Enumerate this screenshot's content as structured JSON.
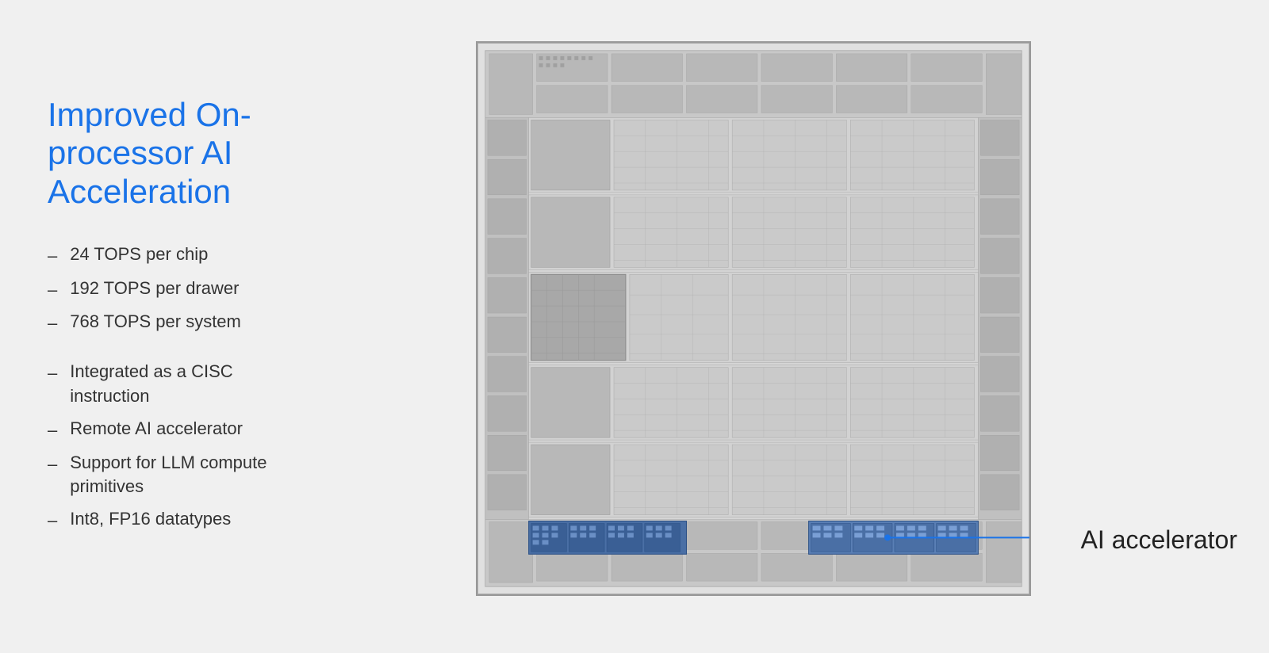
{
  "title": "Improved On-processor AI Acceleration",
  "bullets": {
    "group1": [
      {
        "text": "24 TOPS per chip"
      },
      {
        "text": "192 TOPS per drawer"
      },
      {
        "text": "768 TOPS per system"
      }
    ],
    "group2": [
      {
        "text": "Integrated as a CISC instruction"
      },
      {
        "text": "Remote AI accelerator"
      },
      {
        "text": "Support for LLM compute primitives"
      },
      {
        "text": "Int8, FP16 datatypes"
      }
    ]
  },
  "annotation": {
    "label": "AI accelerator"
  },
  "colors": {
    "title": "#1a73e8",
    "text": "#333333",
    "accent": "#1a73e8"
  }
}
